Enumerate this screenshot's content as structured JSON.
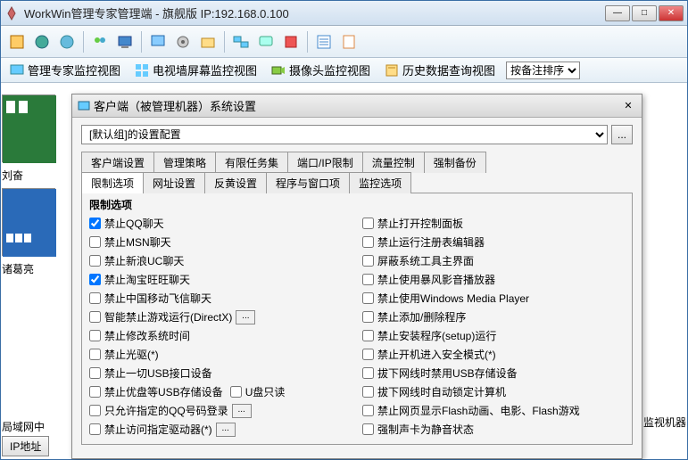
{
  "main": {
    "title": "WorkWin管理专家管理端  -  旗舰版 IP:192.168.0.100"
  },
  "viewbar": {
    "v1": "管理专家监控视图",
    "v2": "电视墙屏幕监控视图",
    "v3": "摄像头监控视图",
    "v4": "历史数据查询视图",
    "sort_label": "按备注排序"
  },
  "thumbs": {
    "t1": "刘奋",
    "t2": "诸葛亮"
  },
  "bottom": {
    "lan_label": "局域网中",
    "ip_btn": "IP地址",
    "right_cut": "监视机器"
  },
  "dialog": {
    "title": "客户端（被管理机器）系统设置",
    "combo_value": "[默认组]的设置配置",
    "browse_btn": "...",
    "tabs_row1": [
      "客户端设置",
      "管理策略",
      "有限任务集",
      "端口/IP限制",
      "流量控制",
      "强制备份"
    ],
    "tabs_row2": [
      "限制选项",
      "网址设置",
      "反黄设置",
      "程序与窗口项",
      "监控选项"
    ],
    "group_title": "限制选项",
    "left_checks": [
      {
        "label": "禁止QQ聊天",
        "checked": true
      },
      {
        "label": "禁止MSN聊天",
        "checked": false
      },
      {
        "label": "禁止新浪UC聊天",
        "checked": false
      },
      {
        "label": "禁止淘宝旺旺聊天",
        "checked": true
      },
      {
        "label": "禁止中国移动飞信聊天",
        "checked": false
      },
      {
        "label": "智能禁止游戏运行(DirectX)",
        "checked": false,
        "dots": true
      },
      {
        "label": "禁止修改系统时间",
        "checked": false
      },
      {
        "label": "禁止光驱(*)",
        "checked": false
      },
      {
        "label": "禁止一切USB接口设备",
        "checked": false
      },
      {
        "label": "禁止优盘等USB存储设备",
        "checked": false,
        "extra": "U盘只读"
      },
      {
        "label": "只允许指定的QQ号码登录",
        "checked": false,
        "dots": true
      },
      {
        "label": "禁止访问指定驱动器(*)",
        "checked": false,
        "dots": true
      }
    ],
    "right_checks": [
      {
        "label": "禁止打开控制面板",
        "checked": false
      },
      {
        "label": "禁止运行注册表编辑器",
        "checked": false
      },
      {
        "label": "屏蔽系统工具主界面",
        "checked": false
      },
      {
        "label": "禁止使用暴风影音播放器",
        "checked": false
      },
      {
        "label": "禁止使用Windows Media Player",
        "checked": false
      },
      {
        "label": "禁止添加/删除程序",
        "checked": false
      },
      {
        "label": "禁止安装程序(setup)运行",
        "checked": false
      },
      {
        "label": "禁止开机进入安全模式(*)",
        "checked": false
      },
      {
        "label": "拔下网线时禁用USB存储设备",
        "checked": false
      },
      {
        "label": "拔下网线时自动锁定计算机",
        "checked": false
      },
      {
        "label": "禁止网页显示Flash动画、电影、Flash游戏",
        "checked": false
      },
      {
        "label": "强制声卡为静音状态",
        "checked": false
      }
    ]
  }
}
